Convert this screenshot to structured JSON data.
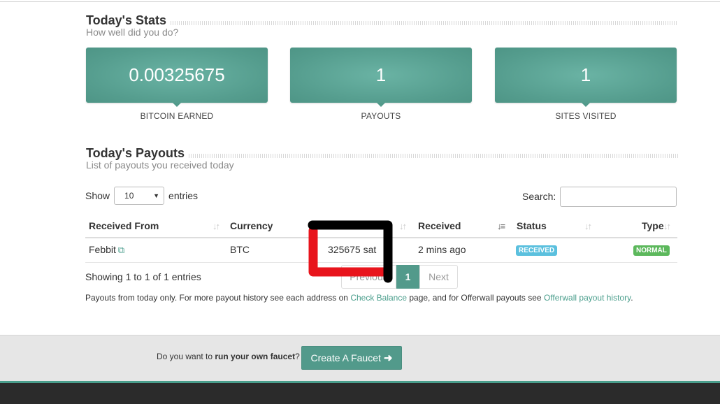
{
  "stats_section": {
    "title": "Today's Stats",
    "subtitle": "How well did you do?"
  },
  "stats": [
    {
      "value": "0.00325675",
      "label": "BITCOIN EARNED"
    },
    {
      "value": "1",
      "label": "PAYOUTS"
    },
    {
      "value": "1",
      "label": "SITES VISITED"
    }
  ],
  "payouts_section": {
    "title": "Today's Payouts",
    "subtitle": "List of payouts you received today"
  },
  "table_controls": {
    "show_label": "Show",
    "entries_value": "10",
    "entries_label": "entries",
    "search_label": "Search:",
    "search_value": ""
  },
  "table": {
    "columns": [
      "Received From",
      "Currency",
      "",
      "Received",
      "Status",
      "Type"
    ],
    "rows": [
      {
        "from": "Febbit",
        "currency": "BTC",
        "amount": "325675 sat",
        "received": "2 mins ago",
        "status": "RECEIVED",
        "type": "NORMAL"
      }
    ]
  },
  "pagination": {
    "info": "Showing 1 to 1 of 1 entries",
    "previous": "Previous",
    "current": "1",
    "next": "Next"
  },
  "note": {
    "part1": "Payouts from today only. For more payout history see each address on ",
    "link1": "Check Balance",
    "part2": " page, and for Offerwall payouts see ",
    "link2": "Offerwall payout history",
    "part3": "."
  },
  "footer": {
    "cta_prefix": "Do you want to ",
    "cta_bold": "run your own faucet",
    "cta_suffix": "?",
    "button_label": "Create A Faucet"
  },
  "colors": {
    "accent": "#529a8b",
    "status_received": "#5bc0de",
    "type_normal": "#5cb85c",
    "annotation_red": "#e8141c",
    "annotation_black": "#000000"
  },
  "icons": [
    "external-link-icon",
    "sort-icon",
    "sort-desc-icon",
    "arrow-right-icon",
    "dropdown-caret-icon"
  ]
}
